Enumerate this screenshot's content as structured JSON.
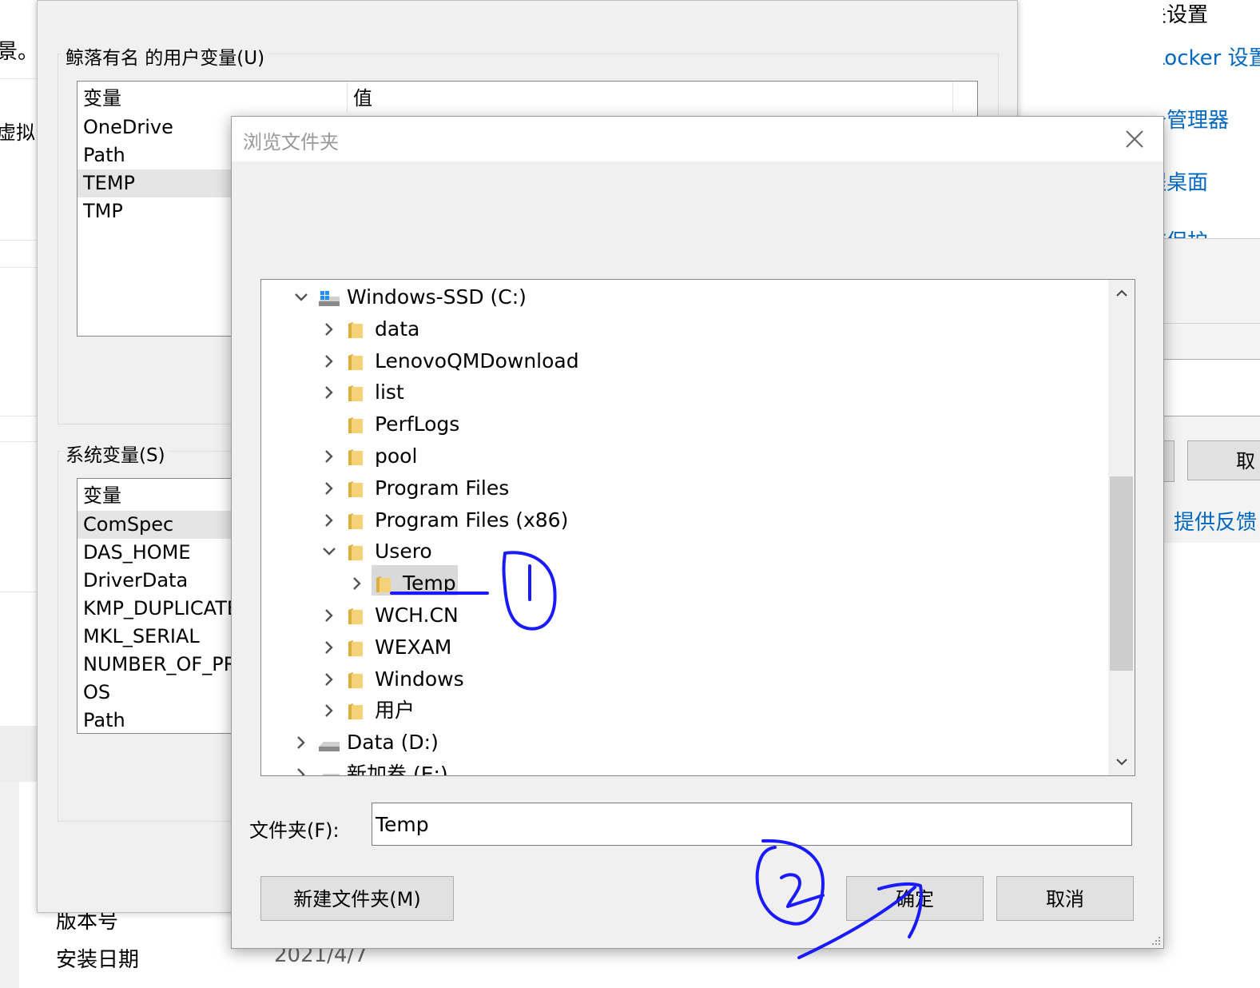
{
  "left_fragments": {
    "top_char": "景。",
    "mid_text": "虚拟"
  },
  "right_settings": {
    "heading": "相关设置",
    "bitlocker": "BitLocker 设置",
    "device_manager": "设备管理器",
    "remote_desktop": "远程桌面",
    "protection": "系统保护",
    "dialog_cancel_fragment": "取",
    "feedback": "提供反馈"
  },
  "env_dialog": {
    "user_group_label": "鲸落有名 的用户变量(U)",
    "user_columns": [
      "变量",
      "值"
    ],
    "user_vars": [
      "OneDrive",
      "Path",
      "TEMP",
      "TMP"
    ],
    "user_selected": "TEMP",
    "system_group_label": "系统变量(S)",
    "system_column": "变量",
    "system_vars": [
      "ComSpec",
      "DAS_HOME",
      "DriverData",
      "KMP_DUPLICATE",
      "MKL_SERIAL",
      "NUMBER_OF_PR",
      "OS",
      "Path"
    ],
    "system_selected": "ComSpec"
  },
  "background_info": {
    "version_label": "版本号",
    "install_date_label": "安装日期",
    "install_date_value": "2021/4/7"
  },
  "browse_dialog": {
    "title": "浏览文件夹",
    "tree": [
      {
        "label": "Windows-SSD (C:)",
        "level": 0,
        "chevron": "down",
        "icon": "drive-icon"
      },
      {
        "label": "data",
        "level": 1,
        "chevron": "right",
        "icon": "folder-icon"
      },
      {
        "label": "LenovoQMDownload",
        "level": 1,
        "chevron": "right",
        "icon": "folder-icon"
      },
      {
        "label": "list",
        "level": 1,
        "chevron": "right",
        "icon": "folder-icon"
      },
      {
        "label": "PerfLogs",
        "level": 1,
        "chevron": "none",
        "icon": "folder-icon"
      },
      {
        "label": "pool",
        "level": 1,
        "chevron": "right",
        "icon": "folder-icon"
      },
      {
        "label": "Program Files",
        "level": 1,
        "chevron": "right",
        "icon": "folder-icon"
      },
      {
        "label": "Program Files (x86)",
        "level": 1,
        "chevron": "right",
        "icon": "folder-icon"
      },
      {
        "label": "Usero",
        "level": 1,
        "chevron": "down",
        "icon": "folder-icon"
      },
      {
        "label": "Temp",
        "level": 2,
        "chevron": "right",
        "icon": "folder-icon",
        "selected": true
      },
      {
        "label": "WCH.CN",
        "level": 1,
        "chevron": "right",
        "icon": "folder-icon"
      },
      {
        "label": "WEXAM",
        "level": 1,
        "chevron": "right",
        "icon": "folder-icon"
      },
      {
        "label": "Windows",
        "level": 1,
        "chevron": "right",
        "icon": "folder-icon"
      },
      {
        "label": "用户",
        "level": 1,
        "chevron": "right",
        "icon": "folder-icon"
      },
      {
        "label": "Data (D:)",
        "level": 0,
        "chevron": "right",
        "icon": "drive-icon"
      },
      {
        "label": "新加卷 (E:)",
        "level": 0,
        "chevron": "right",
        "icon": "drive-icon"
      }
    ],
    "folder_label": "文件夹(F):",
    "folder_value": "Temp",
    "new_folder_button": "新建文件夹(M)",
    "ok_button": "确定",
    "cancel_button": "取消"
  },
  "annotations": {
    "step1": "①",
    "step2": "②",
    "ink_color": "#1a1aff"
  }
}
